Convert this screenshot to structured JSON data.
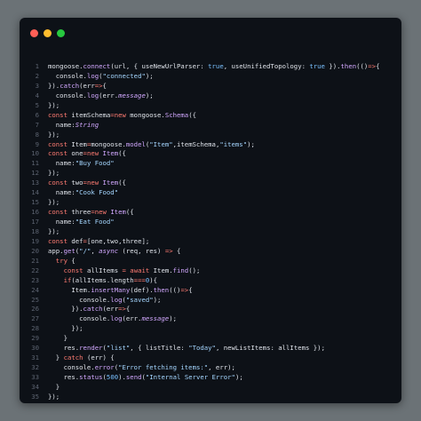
{
  "window": {
    "controls": [
      "close",
      "minimize",
      "zoom"
    ],
    "colors": {
      "background": "#0d1117",
      "close": "#ff5f56",
      "minimize": "#ffbd2e",
      "zoom": "#27c93f"
    }
  },
  "code": {
    "language": "javascript",
    "lines": [
      {
        "n": "1",
        "tokens": [
          [
            "pl",
            "mongoose."
          ],
          [
            "fn",
            "connect"
          ],
          [
            "pl",
            "(url, { useNewUrlParser: "
          ],
          [
            "bool",
            "true"
          ],
          [
            "pl",
            ", useUnifiedTopology: "
          ],
          [
            "bool",
            "true"
          ],
          [
            "pl",
            " })."
          ],
          [
            "fn",
            "then"
          ],
          [
            "pl",
            "(()"
          ],
          [
            "kw",
            "=>"
          ],
          [
            "pl",
            "{"
          ]
        ]
      },
      {
        "n": "2",
        "tokens": [
          [
            "pl",
            "  console."
          ],
          [
            "fn",
            "log"
          ],
          [
            "pl",
            "("
          ],
          [
            "str",
            "\"connected\""
          ],
          [
            "pl",
            ");"
          ]
        ]
      },
      {
        "n": "3",
        "tokens": [
          [
            "pl",
            "})."
          ],
          [
            "fn",
            "catch"
          ],
          [
            "pl",
            "(err"
          ],
          [
            "kw",
            "=>"
          ],
          [
            "pl",
            "{"
          ]
        ]
      },
      {
        "n": "4",
        "tokens": [
          [
            "pl",
            "  console."
          ],
          [
            "fn",
            "log"
          ],
          [
            "pl",
            "(err."
          ],
          [
            "it",
            "message"
          ],
          [
            "pl",
            ");"
          ]
        ]
      },
      {
        "n": "5",
        "tokens": [
          [
            "pl",
            "});"
          ]
        ]
      },
      {
        "n": "6",
        "tokens": [
          [
            "kw",
            "const"
          ],
          [
            "pl",
            " itemSchema"
          ],
          [
            "kw",
            "="
          ],
          [
            "kw",
            "new"
          ],
          [
            "pl",
            " mongoose."
          ],
          [
            "cls",
            "Schema"
          ],
          [
            "pl",
            "({"
          ]
        ]
      },
      {
        "n": "7",
        "tokens": [
          [
            "pl",
            "  name:"
          ],
          [
            "it",
            "String"
          ]
        ]
      },
      {
        "n": "8",
        "tokens": [
          [
            "pl",
            "});"
          ]
        ]
      },
      {
        "n": "9",
        "tokens": [
          [
            "kw",
            "const"
          ],
          [
            "pl",
            " Item"
          ],
          [
            "kw",
            "="
          ],
          [
            "pl",
            "mongoose."
          ],
          [
            "fn",
            "model"
          ],
          [
            "pl",
            "("
          ],
          [
            "str",
            "\"Item\""
          ],
          [
            "pl",
            ",itemSchema,"
          ],
          [
            "str",
            "\"items\""
          ],
          [
            "pl",
            ");"
          ]
        ]
      },
      {
        "n": "10",
        "tokens": [
          [
            "kw",
            "const"
          ],
          [
            "pl",
            " one"
          ],
          [
            "kw",
            "="
          ],
          [
            "kw",
            "new"
          ],
          [
            "pl",
            " "
          ],
          [
            "cls",
            "Item"
          ],
          [
            "pl",
            "({"
          ]
        ]
      },
      {
        "n": "11",
        "tokens": [
          [
            "pl",
            "  name:"
          ],
          [
            "str",
            "\"Buy Food\""
          ]
        ]
      },
      {
        "n": "12",
        "tokens": [
          [
            "pl",
            "});"
          ]
        ]
      },
      {
        "n": "13",
        "tokens": [
          [
            "kw",
            "const"
          ],
          [
            "pl",
            " two"
          ],
          [
            "kw",
            "="
          ],
          [
            "kw",
            "new"
          ],
          [
            "pl",
            " "
          ],
          [
            "cls",
            "Item"
          ],
          [
            "pl",
            "({"
          ]
        ]
      },
      {
        "n": "14",
        "tokens": [
          [
            "pl",
            "  name:"
          ],
          [
            "str",
            "\"Cook Food\""
          ]
        ]
      },
      {
        "n": "15",
        "tokens": [
          [
            "pl",
            "});"
          ]
        ]
      },
      {
        "n": "16",
        "tokens": [
          [
            "kw",
            "const"
          ],
          [
            "pl",
            " three"
          ],
          [
            "kw",
            "="
          ],
          [
            "kw",
            "new"
          ],
          [
            "pl",
            " "
          ],
          [
            "cls",
            "Item"
          ],
          [
            "pl",
            "({"
          ]
        ]
      },
      {
        "n": "17",
        "tokens": [
          [
            "pl",
            "  name:"
          ],
          [
            "str",
            "\"Eat Food\""
          ]
        ]
      },
      {
        "n": "18",
        "tokens": [
          [
            "pl",
            "});"
          ]
        ]
      },
      {
        "n": "19",
        "tokens": [
          [
            "kw",
            "const"
          ],
          [
            "pl",
            " def"
          ],
          [
            "kw",
            "="
          ],
          [
            "pl",
            "[one,two,three];"
          ]
        ]
      },
      {
        "n": "20",
        "tokens": [
          [
            "pl",
            "app."
          ],
          [
            "fn",
            "get"
          ],
          [
            "pl",
            "("
          ],
          [
            "str",
            "\"/\""
          ],
          [
            "pl",
            ", "
          ],
          [
            "it",
            "async"
          ],
          [
            "pl",
            " (req, res) "
          ],
          [
            "kw",
            "=>"
          ],
          [
            "pl",
            " {"
          ]
        ]
      },
      {
        "n": "21",
        "tokens": [
          [
            "pl",
            "  "
          ],
          [
            "kw",
            "try"
          ],
          [
            "pl",
            " {"
          ]
        ]
      },
      {
        "n": "22",
        "tokens": [
          [
            "pl",
            "    "
          ],
          [
            "kw",
            "const"
          ],
          [
            "pl",
            " allItems "
          ],
          [
            "kw",
            "="
          ],
          [
            "pl",
            " "
          ],
          [
            "kw",
            "await"
          ],
          [
            "pl",
            " Item."
          ],
          [
            "fn",
            "find"
          ],
          [
            "pl",
            "();"
          ]
        ]
      },
      {
        "n": "23",
        "tokens": [
          [
            "pl",
            "    "
          ],
          [
            "kw",
            "if"
          ],
          [
            "pl",
            "(allItems.length"
          ],
          [
            "kw",
            "==="
          ],
          [
            "num",
            "0"
          ],
          [
            "pl",
            "){"
          ]
        ]
      },
      {
        "n": "24",
        "tokens": [
          [
            "pl",
            "      Item."
          ],
          [
            "fn",
            "insertMany"
          ],
          [
            "pl",
            "(def)."
          ],
          [
            "fn",
            "then"
          ],
          [
            "pl",
            "(()"
          ],
          [
            "kw",
            "=>"
          ],
          [
            "pl",
            "{"
          ]
        ]
      },
      {
        "n": "25",
        "tokens": [
          [
            "pl",
            "        console."
          ],
          [
            "fn",
            "log"
          ],
          [
            "pl",
            "("
          ],
          [
            "str",
            "\"saved\""
          ],
          [
            "pl",
            ");"
          ]
        ]
      },
      {
        "n": "26",
        "tokens": [
          [
            "pl",
            "      })."
          ],
          [
            "fn",
            "catch"
          ],
          [
            "pl",
            "(err"
          ],
          [
            "kw",
            "=>"
          ],
          [
            "pl",
            "{"
          ]
        ]
      },
      {
        "n": "27",
        "tokens": [
          [
            "pl",
            "        console."
          ],
          [
            "fn",
            "log"
          ],
          [
            "pl",
            "(err."
          ],
          [
            "it",
            "message"
          ],
          [
            "pl",
            ");"
          ]
        ]
      },
      {
        "n": "28",
        "tokens": [
          [
            "pl",
            "      });"
          ]
        ]
      },
      {
        "n": "29",
        "tokens": [
          [
            "pl",
            "    }"
          ]
        ]
      },
      {
        "n": "30",
        "tokens": [
          [
            "pl",
            "    res."
          ],
          [
            "fn",
            "render"
          ],
          [
            "pl",
            "("
          ],
          [
            "str",
            "\"list\""
          ],
          [
            "pl",
            ", { listTitle: "
          ],
          [
            "str",
            "\"Today\""
          ],
          [
            "pl",
            ", newListItems: allItems });"
          ]
        ]
      },
      {
        "n": "31",
        "tokens": [
          [
            "pl",
            "  } "
          ],
          [
            "kw",
            "catch"
          ],
          [
            "pl",
            " (err) {"
          ]
        ]
      },
      {
        "n": "32",
        "tokens": [
          [
            "pl",
            "    console."
          ],
          [
            "fn",
            "error"
          ],
          [
            "pl",
            "("
          ],
          [
            "str",
            "\"Error fetching items:\""
          ],
          [
            "pl",
            ", err);"
          ]
        ]
      },
      {
        "n": "33",
        "tokens": [
          [
            "pl",
            "    res."
          ],
          [
            "fn",
            "status"
          ],
          [
            "pl",
            "("
          ],
          [
            "num",
            "500"
          ],
          [
            "pl",
            ")."
          ],
          [
            "fn",
            "send"
          ],
          [
            "pl",
            "("
          ],
          [
            "str",
            "\"Internal Server Error\""
          ],
          [
            "pl",
            ");"
          ]
        ]
      },
      {
        "n": "34",
        "tokens": [
          [
            "pl",
            "  }"
          ]
        ]
      },
      {
        "n": "35",
        "tokens": [
          [
            "pl",
            "});"
          ]
        ]
      }
    ]
  }
}
